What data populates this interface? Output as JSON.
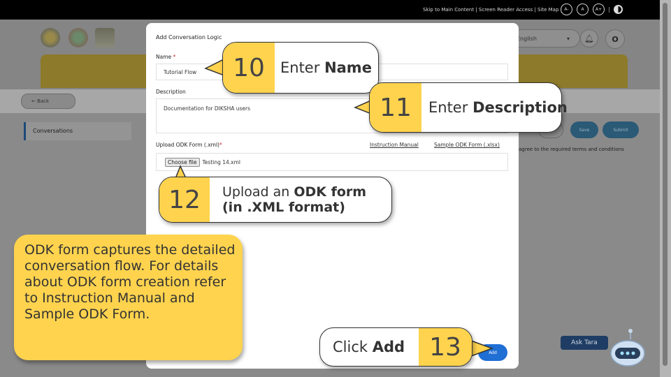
{
  "top_links": "Skip to Main Content | Screen Reader Access | Site Map |",
  "font_size_buttons": [
    "A-",
    "A",
    "A+"
  ],
  "header": {
    "language": "English",
    "profile_initial": "O"
  },
  "back_label": "← Back",
  "side_tab": "Conversations",
  "actions": {
    "save": "Save",
    "submit": "Submit"
  },
  "terms_text": "agree to the required terms and conditions",
  "modal": {
    "title": "Add Conversation Logic",
    "name_label": "Name",
    "name_value": "Tutorial Flow",
    "description_label": "Description",
    "description_value": "Documentation for DIKSHA users",
    "upload_label": "Upload ODK Form (.xml)",
    "instruction_link": "Instruction Manual",
    "sample_link": "Sample ODK Form (.xlsx)",
    "choose_file": "Choose file",
    "file_name": "Testing 14.xml",
    "add": "Add"
  },
  "callouts": {
    "c10": {
      "num": "10",
      "pre": "Enter ",
      "bold": "Name"
    },
    "c11": {
      "num": "11",
      "pre": "Enter ",
      "bold": "Description"
    },
    "c12": {
      "num": "12",
      "pre": "Upload an ",
      "bold1": "ODK form",
      "bold2": "(in .XML format)"
    },
    "c13": {
      "num": "13",
      "pre": "Click ",
      "bold": "Add"
    }
  },
  "note": "ODK form captures the detailed conversation flow. For details about ODK form creation refer to Instruction Manual and Sample ODK Form.",
  "assistant": "Ask Tara",
  "colors": {
    "callout_yellow": "#ffd34e",
    "primary_blue": "#1f6fd4",
    "required_red": "#d8262d"
  }
}
